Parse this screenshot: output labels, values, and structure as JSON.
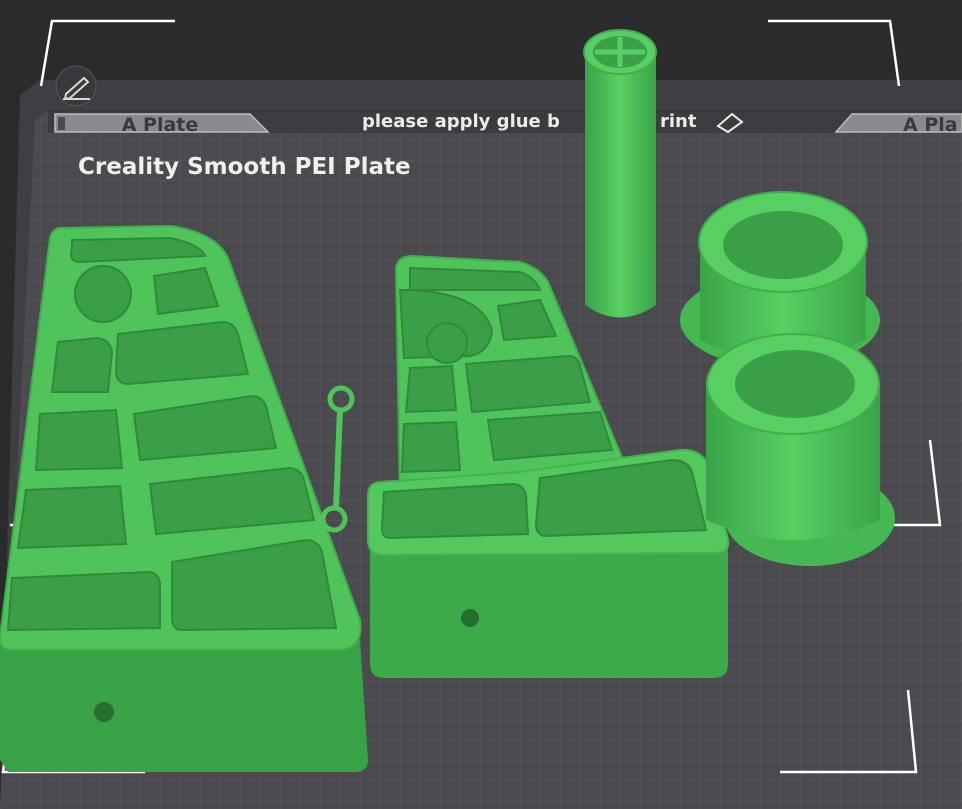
{
  "plate": {
    "left_tab_label": "A Plate",
    "right_tab_label": "A Pla",
    "notice": "please apply glue b",
    "notice_tail": "rint",
    "plate_type": "Creality Smooth PEI Plate"
  },
  "icons": {
    "edit": "pencil-icon",
    "eraser": "eraser-icon"
  },
  "colors": {
    "background": "#2b2b2e",
    "plate": "#4a4a4e",
    "grid": "#5a5a5f",
    "model": "#4ec25a",
    "model_dark": "#2f8a3a",
    "text": "#e8e8e8"
  }
}
